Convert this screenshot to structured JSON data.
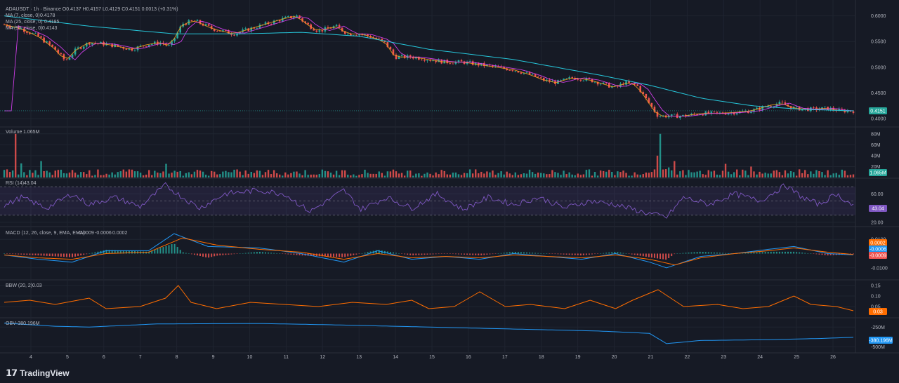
{
  "header": {
    "symbol": "ADAUSDT",
    "interval": "1h",
    "exchange": "Binance",
    "ohlc": "O0.4137  H0.4157  L0.4129  C0.4151  0.0013 (+0.31%)"
  },
  "legend": {
    "ma7": {
      "label": "MA (7, close, 0)",
      "value": "0.4178",
      "color": "#f7a21b"
    },
    "ma25": {
      "label": "MA (25, close, 0)",
      "value": "0.4185",
      "color": "#e040fb"
    },
    "ma99": {
      "label": "MA (99, close, 0)",
      "value": "0.4143",
      "color": "#26c6da"
    }
  },
  "panes": {
    "volume": {
      "label": "Volume",
      "value": "1.065M",
      "tag": "1.065M"
    },
    "rsi": {
      "label": "RSI (14)",
      "value": "43.04",
      "tag": "43.04"
    },
    "macd": {
      "label": "MACD (12, 26, close, 9, EMA, EMA)",
      "v1": "-0.0009",
      "v2": "-0.0006",
      "v3": "0.0002",
      "tags": [
        "0.0002",
        "-0.0006",
        "-0.0009"
      ]
    },
    "bbw": {
      "label": "BBW (20, 2)",
      "value": "0.03",
      "tag": "0.03"
    },
    "obv": {
      "label": "OBV",
      "value": "-380.196M",
      "tag": "-380.196M"
    }
  },
  "price_tag": "0.4151",
  "brand": {
    "name": "TradingView"
  },
  "colors": {
    "up": "#26a69a",
    "down": "#ef5350",
    "rsi": "#7e57c2",
    "macd": "#2196f3",
    "signal": "#ff6d00",
    "bbw": "#ff6d00",
    "obv": "#2196f3"
  },
  "chart_data": {
    "type": "candlestick",
    "x_ticks": [
      "4",
      "5",
      "6",
      "7",
      "8",
      "9",
      "10",
      "11",
      "12",
      "13",
      "14",
      "15",
      "16",
      "17",
      "18",
      "19",
      "20",
      "21",
      "22",
      "23",
      "24",
      "25",
      "26"
    ],
    "price_axis": {
      "ticks": [
        "0.6000",
        "0.5500",
        "0.5000",
        "0.4500",
        "0.4000"
      ],
      "ylim": [
        0.385,
        0.62
      ]
    },
    "price_path": [
      [
        0,
        0.583
      ],
      [
        0.02,
        0.575
      ],
      [
        0.04,
        0.56
      ],
      [
        0.06,
        0.535
      ],
      [
        0.072,
        0.512
      ],
      [
        0.085,
        0.535
      ],
      [
        0.1,
        0.548
      ],
      [
        0.12,
        0.545
      ],
      [
        0.15,
        0.535
      ],
      [
        0.17,
        0.545
      ],
      [
        0.185,
        0.548
      ],
      [
        0.195,
        0.54
      ],
      [
        0.21,
        0.585
      ],
      [
        0.225,
        0.59
      ],
      [
        0.245,
        0.575
      ],
      [
        0.27,
        0.565
      ],
      [
        0.29,
        0.575
      ],
      [
        0.31,
        0.585
      ],
      [
        0.33,
        0.595
      ],
      [
        0.345,
        0.6
      ],
      [
        0.355,
        0.585
      ],
      [
        0.37,
        0.57
      ],
      [
        0.39,
        0.58
      ],
      [
        0.405,
        0.565
      ],
      [
        0.42,
        0.565
      ],
      [
        0.44,
        0.555
      ],
      [
        0.45,
        0.545
      ],
      [
        0.46,
        0.52
      ],
      [
        0.48,
        0.52
      ],
      [
        0.5,
        0.515
      ],
      [
        0.52,
        0.51
      ],
      [
        0.54,
        0.51
      ],
      [
        0.56,
        0.505
      ],
      [
        0.58,
        0.5
      ],
      [
        0.6,
        0.495
      ],
      [
        0.62,
        0.485
      ],
      [
        0.635,
        0.475
      ],
      [
        0.65,
        0.47
      ],
      [
        0.67,
        0.48
      ],
      [
        0.69,
        0.475
      ],
      [
        0.71,
        0.465
      ],
      [
        0.72,
        0.46
      ],
      [
        0.73,
        0.47
      ],
      [
        0.745,
        0.465
      ],
      [
        0.755,
        0.44
      ],
      [
        0.77,
        0.405
      ],
      [
        0.785,
        0.405
      ],
      [
        0.8,
        0.405
      ],
      [
        0.82,
        0.41
      ],
      [
        0.84,
        0.41
      ],
      [
        0.86,
        0.412
      ],
      [
        0.88,
        0.415
      ],
      [
        0.9,
        0.425
      ],
      [
        0.915,
        0.43
      ],
      [
        0.93,
        0.42
      ],
      [
        0.95,
        0.418
      ],
      [
        0.97,
        0.42
      ],
      [
        0.985,
        0.415
      ],
      [
        1,
        0.415
      ]
    ],
    "ma99_path": [
      [
        0,
        0.6
      ],
      [
        0.1,
        0.58
      ],
      [
        0.2,
        0.565
      ],
      [
        0.28,
        0.565
      ],
      [
        0.35,
        0.568
      ],
      [
        0.42,
        0.56
      ],
      [
        0.5,
        0.535
      ],
      [
        0.6,
        0.515
      ],
      [
        0.7,
        0.485
      ],
      [
        0.76,
        0.465
      ],
      [
        0.82,
        0.44
      ],
      [
        0.88,
        0.425
      ],
      [
        0.94,
        0.418
      ],
      [
        1,
        0.415
      ]
    ],
    "volume_axis": {
      "ticks": [
        "80M",
        "60M",
        "40M",
        "20M"
      ],
      "ylim": [
        0,
        90
      ]
    },
    "volume_spikes": [
      [
        0.013,
        80
      ],
      [
        0.774,
        80
      ],
      [
        0.044,
        30
      ],
      [
        0.19,
        25
      ],
      [
        0.77,
        40
      ],
      [
        0.79,
        30
      ],
      [
        0.85,
        25
      ],
      [
        0.88,
        20
      ]
    ],
    "rsi_axis": {
      "ticks": [
        "60.00",
        "40.00",
        "20.00"
      ],
      "ylim": [
        15,
        80
      ],
      "upper": 70,
      "lower": 30
    },
    "rsi_path": [
      [
        0,
        43
      ],
      [
        0.02,
        55
      ],
      [
        0.05,
        40
      ],
      [
        0.08,
        60
      ],
      [
        0.1,
        45
      ],
      [
        0.13,
        55
      ],
      [
        0.16,
        42
      ],
      [
        0.19,
        72
      ],
      [
        0.21,
        55
      ],
      [
        0.23,
        40
      ],
      [
        0.26,
        60
      ],
      [
        0.3,
        65
      ],
      [
        0.33,
        60
      ],
      [
        0.36,
        35
      ],
      [
        0.4,
        65
      ],
      [
        0.42,
        38
      ],
      [
        0.45,
        55
      ],
      [
        0.48,
        40
      ],
      [
        0.51,
        60
      ],
      [
        0.54,
        38
      ],
      [
        0.57,
        55
      ],
      [
        0.6,
        45
      ],
      [
        0.63,
        55
      ],
      [
        0.66,
        40
      ],
      [
        0.69,
        50
      ],
      [
        0.72,
        45
      ],
      [
        0.75,
        35
      ],
      [
        0.78,
        27
      ],
      [
        0.8,
        55
      ],
      [
        0.83,
        45
      ],
      [
        0.86,
        60
      ],
      [
        0.89,
        50
      ],
      [
        0.92,
        72
      ],
      [
        0.94,
        55
      ],
      [
        0.96,
        45
      ],
      [
        0.98,
        60
      ],
      [
        1,
        43
      ]
    ],
    "macd_axis": {
      "ticks": [
        "0.0100",
        "-0.0100"
      ],
      "ylim": [
        -0.018,
        0.018
      ]
    },
    "macd_path": [
      [
        0,
        -0.001
      ],
      [
        0.04,
        -0.004
      ],
      [
        0.08,
        -0.006
      ],
      [
        0.12,
        0.002
      ],
      [
        0.17,
        0.002
      ],
      [
        0.2,
        0.014
      ],
      [
        0.24,
        0.005
      ],
      [
        0.3,
        0.004
      ],
      [
        0.35,
        0.0
      ],
      [
        0.4,
        -0.006
      ],
      [
        0.44,
        0.002
      ],
      [
        0.48,
        -0.004
      ],
      [
        0.52,
        -0.002
      ],
      [
        0.56,
        -0.004
      ],
      [
        0.6,
        0.0
      ],
      [
        0.64,
        -0.002
      ],
      [
        0.68,
        -0.004
      ],
      [
        0.72,
        0.0
      ],
      [
        0.76,
        -0.006
      ],
      [
        0.78,
        -0.01
      ],
      [
        0.82,
        -0.002
      ],
      [
        0.86,
        0.0
      ],
      [
        0.9,
        0.003
      ],
      [
        0.93,
        0.005
      ],
      [
        0.97,
        0.0
      ],
      [
        1,
        -0.0009
      ]
    ],
    "signal_path": [
      [
        0,
        -0.001
      ],
      [
        0.04,
        -0.003
      ],
      [
        0.08,
        -0.004
      ],
      [
        0.12,
        0.0
      ],
      [
        0.17,
        0.001
      ],
      [
        0.21,
        0.011
      ],
      [
        0.25,
        0.006
      ],
      [
        0.3,
        0.003
      ],
      [
        0.35,
        0.001
      ],
      [
        0.4,
        -0.004
      ],
      [
        0.44,
        0.0
      ],
      [
        0.48,
        -0.003
      ],
      [
        0.52,
        -0.002
      ],
      [
        0.56,
        -0.003
      ],
      [
        0.6,
        -0.001
      ],
      [
        0.64,
        -0.002
      ],
      [
        0.68,
        -0.003
      ],
      [
        0.72,
        -0.001
      ],
      [
        0.76,
        -0.004
      ],
      [
        0.79,
        -0.008
      ],
      [
        0.82,
        -0.003
      ],
      [
        0.86,
        0.0
      ],
      [
        0.9,
        0.002
      ],
      [
        0.93,
        0.004
      ],
      [
        0.97,
        0.001
      ],
      [
        1,
        -0.0006
      ]
    ],
    "bbw_axis": {
      "ticks": [
        "0.15",
        "0.10",
        "0.05"
      ],
      "ylim": [
        0.0,
        0.17
      ]
    },
    "bbw_path": [
      [
        0,
        0.07
      ],
      [
        0.03,
        0.08
      ],
      [
        0.06,
        0.06
      ],
      [
        0.1,
        0.09
      ],
      [
        0.12,
        0.04
      ],
      [
        0.16,
        0.05
      ],
      [
        0.19,
        0.09
      ],
      [
        0.205,
        0.15
      ],
      [
        0.22,
        0.07
      ],
      [
        0.25,
        0.04
      ],
      [
        0.29,
        0.07
      ],
      [
        0.33,
        0.06
      ],
      [
        0.37,
        0.05
      ],
      [
        0.41,
        0.07
      ],
      [
        0.45,
        0.06
      ],
      [
        0.48,
        0.08
      ],
      [
        0.5,
        0.04
      ],
      [
        0.53,
        0.05
      ],
      [
        0.56,
        0.12
      ],
      [
        0.59,
        0.05
      ],
      [
        0.62,
        0.06
      ],
      [
        0.66,
        0.04
      ],
      [
        0.69,
        0.08
      ],
      [
        0.72,
        0.04
      ],
      [
        0.74,
        0.08
      ],
      [
        0.77,
        0.13
      ],
      [
        0.8,
        0.05
      ],
      [
        0.84,
        0.06
      ],
      [
        0.87,
        0.04
      ],
      [
        0.9,
        0.05
      ],
      [
        0.93,
        0.1
      ],
      [
        0.95,
        0.06
      ],
      [
        0.98,
        0.05
      ],
      [
        1,
        0.03
      ]
    ],
    "obv_axis": {
      "ticks": [
        "-250M",
        "-500M"
      ],
      "ylim": [
        -550,
        -150
      ]
    },
    "obv_path": [
      [
        0,
        -200
      ],
      [
        0.06,
        -240
      ],
      [
        0.1,
        -250
      ],
      [
        0.18,
        -210
      ],
      [
        0.3,
        -205
      ],
      [
        0.38,
        -220
      ],
      [
        0.5,
        -250
      ],
      [
        0.6,
        -275
      ],
      [
        0.7,
        -300
      ],
      [
        0.76,
        -330
      ],
      [
        0.78,
        -460
      ],
      [
        0.82,
        -420
      ],
      [
        0.9,
        -410
      ],
      [
        0.96,
        -395
      ],
      [
        1,
        -380
      ]
    ]
  }
}
